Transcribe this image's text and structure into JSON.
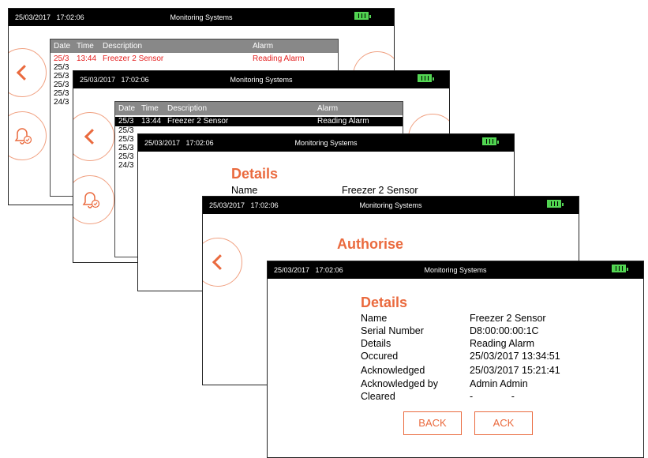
{
  "status": {
    "datetime": "25/03/2017   17:02:06",
    "title": "Monitoring Systems"
  },
  "alarm_list": {
    "columns": [
      "Date",
      "Time",
      "Description",
      "Alarm"
    ],
    "rows": [
      {
        "date": "25/3",
        "time": "13:44",
        "description": "Freezer 2 Sensor",
        "alarm": "Reading Alarm"
      },
      {
        "date": "25/3",
        "time": "",
        "description": "",
        "alarm": ""
      },
      {
        "date": "25/3",
        "time": "",
        "description": "",
        "alarm": ""
      },
      {
        "date": "25/3",
        "time": "",
        "description": "",
        "alarm": ""
      },
      {
        "date": "25/3",
        "time": "",
        "description": "",
        "alarm": ""
      },
      {
        "date": "24/3",
        "time": "",
        "description": "",
        "alarm": ""
      }
    ]
  },
  "screen3": {
    "heading": "Details",
    "name_label": "Name",
    "name_value": "Freezer 2 Sensor"
  },
  "screen4": {
    "heading": "Authorise"
  },
  "details": {
    "heading": "Details",
    "fields": [
      {
        "label": "Name",
        "value": "Freezer 2 Sensor"
      },
      {
        "label": "Serial Number",
        "value": "D8:00:00:00:1C"
      },
      {
        "label": "Details",
        "value": "Reading Alarm"
      },
      {
        "label": "Occured",
        "value": "25/03/2017 13:34:51"
      },
      {
        "label": "Acknowledged",
        "value": "25/03/2017 15:21:41"
      },
      {
        "label": "Acknowledged by",
        "value": "Admin Admin"
      },
      {
        "label": "Cleared",
        "value": "-              -"
      }
    ],
    "back_label": "BACK",
    "ack_label": "ACK"
  },
  "colors": {
    "accent": "#ea6a3e",
    "alarm_red": "#e41e1e",
    "battery": "#4cd14c"
  },
  "icons": [
    "chevron-left-icon",
    "bell-check-icon",
    "battery-icon"
  ]
}
